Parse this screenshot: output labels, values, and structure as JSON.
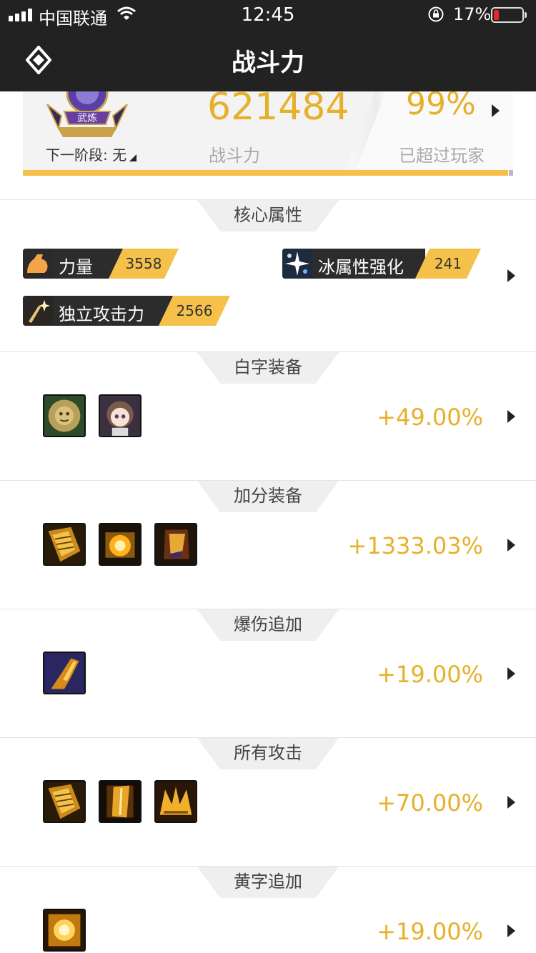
{
  "status": {
    "carrier": "中国联通",
    "time": "12:45",
    "battery_pct": "17%"
  },
  "nav": {
    "title": "战斗力"
  },
  "hero": {
    "emblem_text": "武炼",
    "next_stage": "下一阶段: 无",
    "power_value": "621484",
    "power_label": "战斗力",
    "percent_value": "99%",
    "percent_label": "已超过玩家",
    "progress_fraction": 0.99
  },
  "core": {
    "title": "核心属性",
    "attrs": [
      {
        "name": "力量",
        "value": "3558",
        "icon": "flexed-arm-icon"
      },
      {
        "name": "冰属性强化",
        "value": "241",
        "icon": "ice-sparkle-icon"
      },
      {
        "name": "独立攻击力",
        "value": "2566",
        "icon": "sword-sparkle-icon"
      }
    ]
  },
  "sections": [
    {
      "title": "白字装备",
      "bonus": "+49.00%",
      "icons": [
        "lion-emblem-icon",
        "doll-avatar-icon"
      ]
    },
    {
      "title": "加分装备",
      "bonus": "+1333.03%",
      "icons": [
        "gold-armor-icon",
        "gold-chest-icon",
        "gold-bracer-icon"
      ]
    },
    {
      "title": "爆伤追加",
      "bonus": "+19.00%",
      "icons": [
        "boot-item-icon"
      ]
    },
    {
      "title": "所有攻击",
      "bonus": "+70.00%",
      "icons": [
        "gold-armor-icon",
        "gold-book-icon",
        "gold-crown-icon"
      ]
    },
    {
      "title": "黄字追加",
      "bonus": "+19.00%",
      "icons": [
        "gold-box-icon"
      ]
    }
  ]
}
